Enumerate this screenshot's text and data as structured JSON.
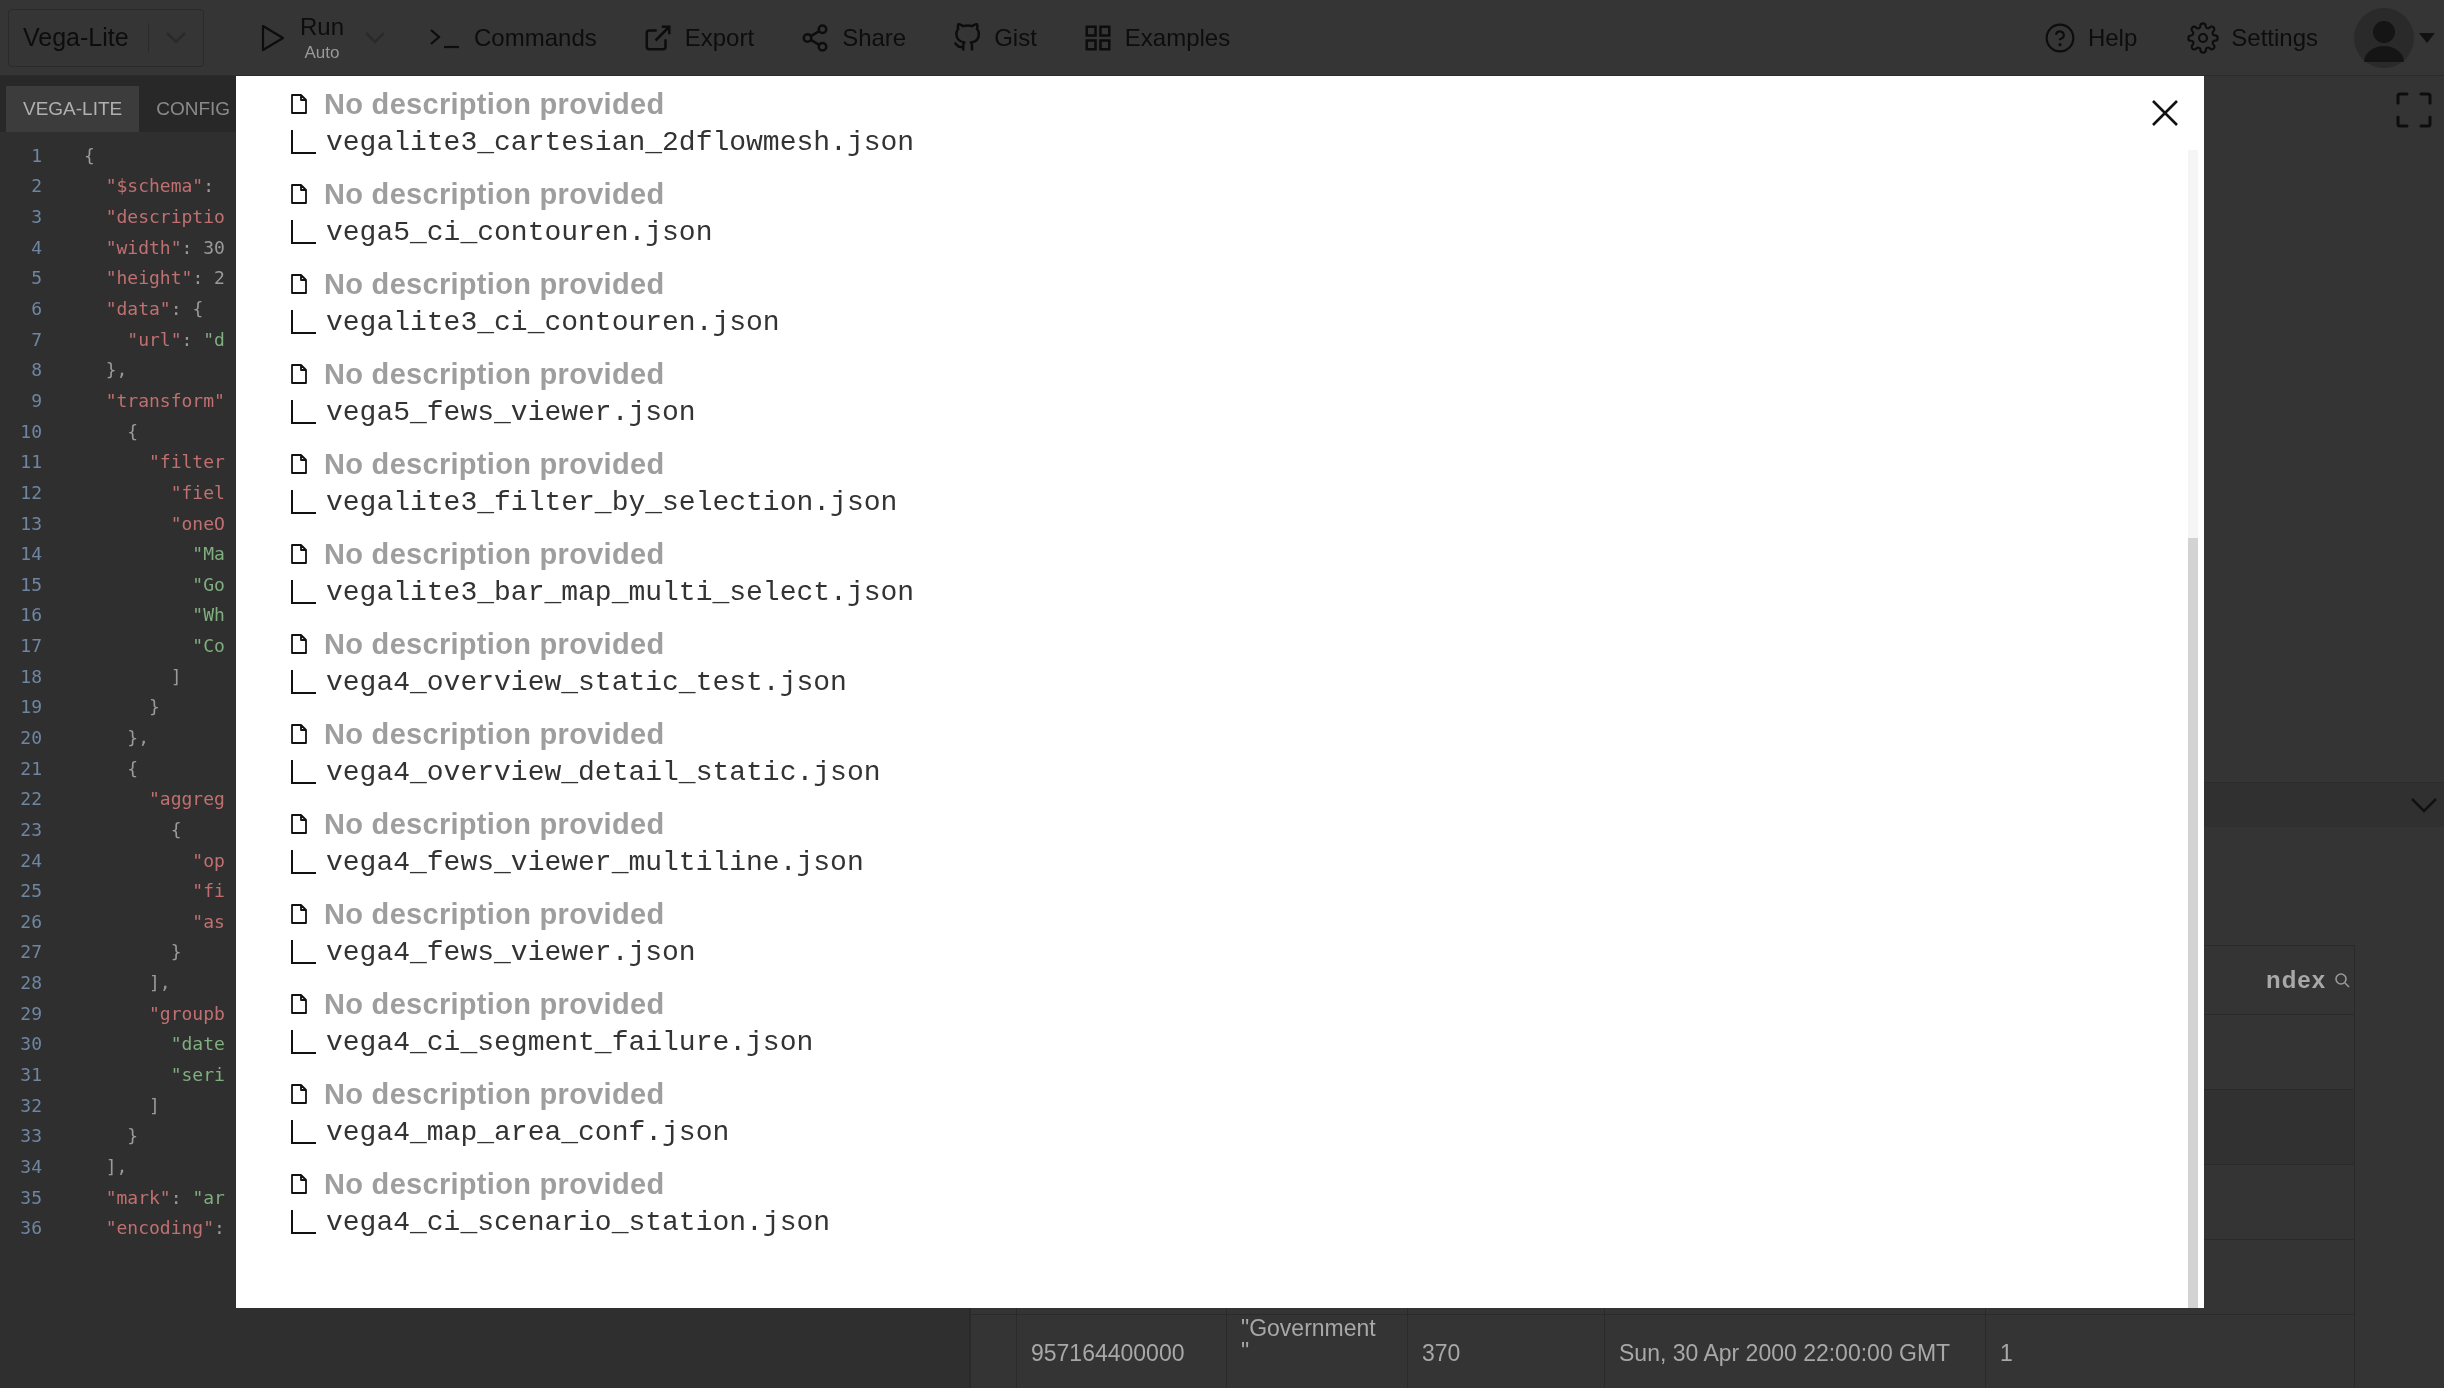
{
  "header": {
    "mode_select": "Vega-Lite",
    "run": {
      "label": "Run",
      "mode": "Auto"
    },
    "menu": [
      {
        "kind": "commands",
        "label": "Commands"
      },
      {
        "kind": "export",
        "label": "Export"
      },
      {
        "kind": "share",
        "label": "Share"
      },
      {
        "kind": "gist",
        "label": "Gist"
      },
      {
        "kind": "examples",
        "label": "Examples"
      }
    ],
    "right_menu": [
      {
        "kind": "help",
        "label": "Help"
      },
      {
        "kind": "settings",
        "label": "Settings"
      }
    ]
  },
  "editor": {
    "tabs": [
      {
        "label": "VEGA-LITE",
        "selected": true
      },
      {
        "label": "CONFIG",
        "selected": false
      }
    ],
    "lines": [
      {
        "number": "1",
        "tokens": [
          {
            "kind": "punct",
            "text": "{"
          }
        ]
      },
      {
        "number": "2",
        "tokens": [
          {
            "kind": "key",
            "text": "  \"$schema\""
          },
          {
            "kind": "punct",
            "text": ":"
          }
        ]
      },
      {
        "number": "3",
        "tokens": [
          {
            "kind": "key",
            "text": "  \"descriptio"
          }
        ]
      },
      {
        "number": "4",
        "tokens": [
          {
            "kind": "key",
            "text": "  \"width\""
          },
          {
            "kind": "punct",
            "text": ": 30"
          }
        ]
      },
      {
        "number": "5",
        "tokens": [
          {
            "kind": "key",
            "text": "  \"height\""
          },
          {
            "kind": "punct",
            "text": ": 2"
          }
        ]
      },
      {
        "number": "6",
        "tokens": [
          {
            "kind": "key",
            "text": "  \"data\""
          },
          {
            "kind": "punct",
            "text": ": {"
          }
        ]
      },
      {
        "number": "7",
        "tokens": [
          {
            "kind": "key",
            "text": "    \"url\""
          },
          {
            "kind": "punct",
            "text": ": "
          },
          {
            "kind": "string",
            "text": "\"d"
          }
        ]
      },
      {
        "number": "8",
        "tokens": [
          {
            "kind": "punct",
            "text": "  },"
          }
        ]
      },
      {
        "number": "9",
        "tokens": [
          {
            "kind": "key",
            "text": "  \"transform\""
          }
        ]
      },
      {
        "number": "10",
        "tokens": [
          {
            "kind": "punct",
            "text": "    {"
          }
        ]
      },
      {
        "number": "11",
        "tokens": [
          {
            "kind": "key",
            "text": "      \"filter"
          }
        ]
      },
      {
        "number": "12",
        "tokens": [
          {
            "kind": "key",
            "text": "        \"fiel"
          }
        ]
      },
      {
        "number": "13",
        "tokens": [
          {
            "kind": "key",
            "text": "        \"oneO"
          }
        ]
      },
      {
        "number": "14",
        "tokens": [
          {
            "kind": "string",
            "text": "          \"Ma"
          }
        ]
      },
      {
        "number": "15",
        "tokens": [
          {
            "kind": "string",
            "text": "          \"Go"
          }
        ]
      },
      {
        "number": "16",
        "tokens": [
          {
            "kind": "string",
            "text": "          \"Wh"
          }
        ]
      },
      {
        "number": "17",
        "tokens": [
          {
            "kind": "string",
            "text": "          \"Co"
          }
        ]
      },
      {
        "number": "18",
        "tokens": [
          {
            "kind": "punct",
            "text": "        ]"
          }
        ]
      },
      {
        "number": "19",
        "tokens": [
          {
            "kind": "punct",
            "text": "      }"
          }
        ]
      },
      {
        "number": "20",
        "tokens": [
          {
            "kind": "punct",
            "text": "    },"
          }
        ]
      },
      {
        "number": "21",
        "tokens": [
          {
            "kind": "punct",
            "text": "    {"
          }
        ]
      },
      {
        "number": "22",
        "tokens": [
          {
            "kind": "key",
            "text": "      \"aggreg"
          }
        ]
      },
      {
        "number": "23",
        "tokens": [
          {
            "kind": "punct",
            "text": "        {"
          }
        ]
      },
      {
        "number": "24",
        "tokens": [
          {
            "kind": "key",
            "text": "          \"op"
          }
        ]
      },
      {
        "number": "25",
        "tokens": [
          {
            "kind": "key",
            "text": "          \"fi"
          }
        ]
      },
      {
        "number": "26",
        "tokens": [
          {
            "kind": "key",
            "text": "          \"as"
          }
        ]
      },
      {
        "number": "27",
        "tokens": [
          {
            "kind": "punct",
            "text": "        }"
          }
        ]
      },
      {
        "number": "28",
        "tokens": [
          {
            "kind": "punct",
            "text": "      ],"
          }
        ]
      },
      {
        "number": "29",
        "tokens": [
          {
            "kind": "key",
            "text": "      \"groupb"
          }
        ]
      },
      {
        "number": "30",
        "tokens": [
          {
            "kind": "string",
            "text": "        \"date"
          }
        ]
      },
      {
        "number": "31",
        "tokens": [
          {
            "kind": "string",
            "text": "        \"seri"
          }
        ]
      },
      {
        "number": "32",
        "tokens": [
          {
            "kind": "punct",
            "text": "      ]"
          }
        ]
      },
      {
        "number": "33",
        "tokens": [
          {
            "kind": "punct",
            "text": "    }"
          }
        ]
      },
      {
        "number": "34",
        "tokens": [
          {
            "kind": "punct",
            "text": "  ],"
          }
        ]
      },
      {
        "number": "35",
        "tokens": [
          {
            "kind": "key",
            "text": "  \"mark\""
          },
          {
            "kind": "punct",
            "text": ": "
          },
          {
            "kind": "string",
            "text": "\"ar"
          }
        ]
      },
      {
        "number": "36",
        "tokens": [
          {
            "kind": "key",
            "text": "  \"encoding\""
          },
          {
            "kind": "punct",
            "text": ":"
          }
        ]
      }
    ]
  },
  "data_table": {
    "header_cell": "ndex",
    "row": [
      "957164400000",
      "\"Government\n\"",
      "370",
      "Sun, 30 Apr 2000 22:00:00 GMT",
      "1"
    ]
  },
  "examples_dialog": {
    "items": [
      {
        "description": "No description provided",
        "file": "vegalite3_cartesian_2dflowmesh.json"
      },
      {
        "description": "No description provided",
        "file": "vega5_ci_contouren.json"
      },
      {
        "description": "No description provided",
        "file": "vegalite3_ci_contouren.json"
      },
      {
        "description": "No description provided",
        "file": "vega5_fews_viewer.json"
      },
      {
        "description": "No description provided",
        "file": "vegalite3_filter_by_selection.json"
      },
      {
        "description": "No description provided",
        "file": "vegalite3_bar_map_multi_select.json"
      },
      {
        "description": "No description provided",
        "file": "vega4_overview_static_test.json"
      },
      {
        "description": "No description provided",
        "file": "vega4_overview_detail_static.json"
      },
      {
        "description": "No description provided",
        "file": "vega4_fews_viewer_multiline.json"
      },
      {
        "description": "No description provided",
        "file": "vega4_fews_viewer.json"
      },
      {
        "description": "No description provided",
        "file": "vega4_ci_segment_failure.json"
      },
      {
        "description": "No description provided",
        "file": "vega4_map_area_conf.json"
      },
      {
        "description": "No description provided",
        "file": "vega4_ci_scenario_station.json"
      }
    ]
  }
}
